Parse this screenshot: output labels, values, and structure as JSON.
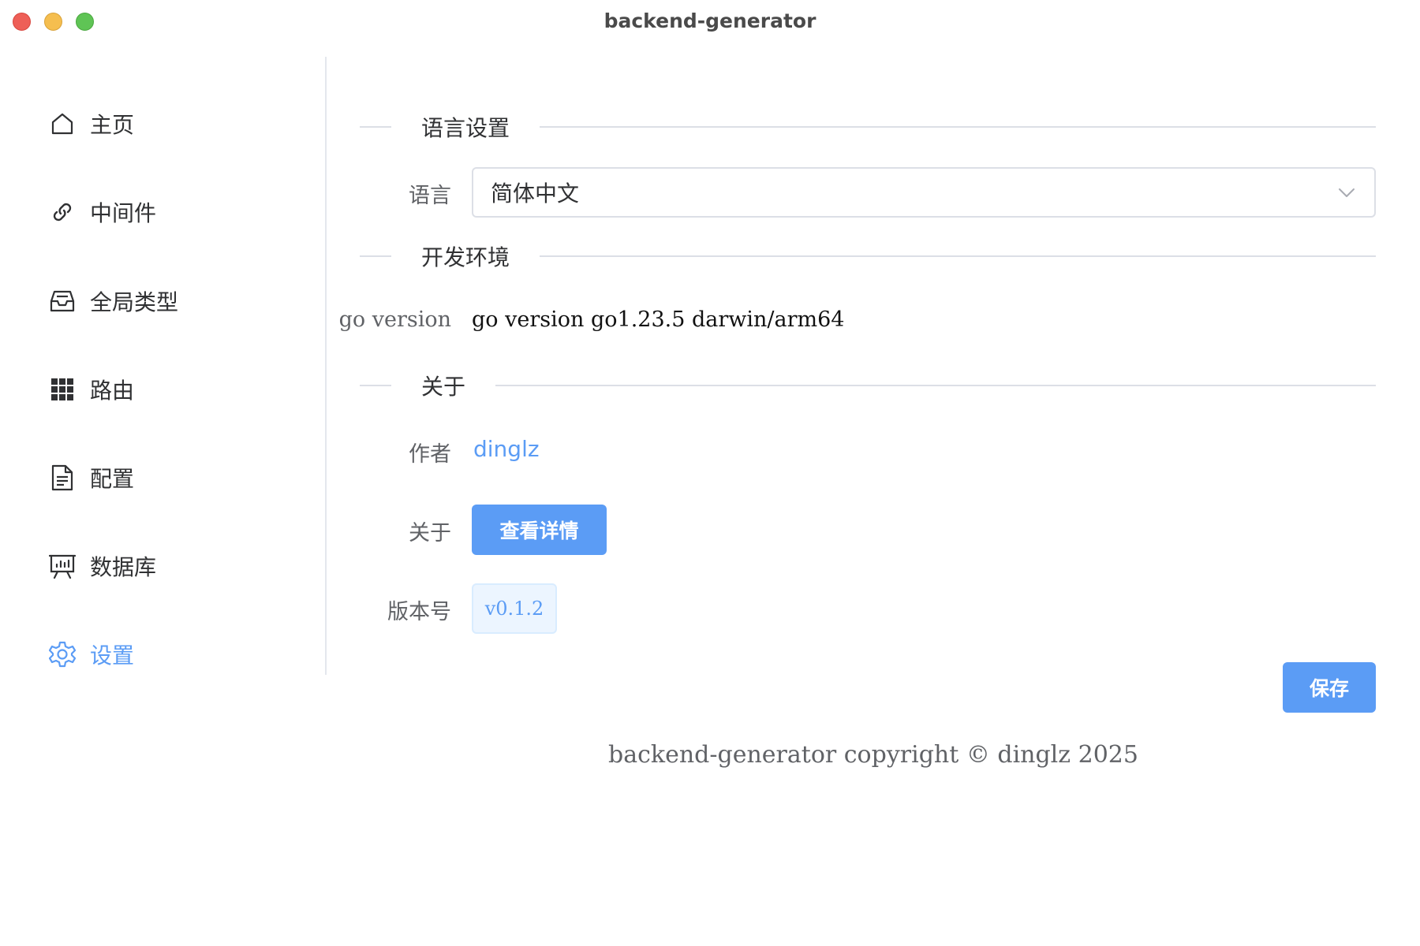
{
  "window": {
    "title": "backend-generator"
  },
  "sidebar": {
    "items": [
      {
        "label": "主页",
        "icon": "home-icon",
        "active": false
      },
      {
        "label": "中间件",
        "icon": "link-icon",
        "active": false
      },
      {
        "label": "全局类型",
        "icon": "inbox-icon",
        "active": false
      },
      {
        "label": "路由",
        "icon": "grid-icon",
        "active": false
      },
      {
        "label": "配置",
        "icon": "document-icon",
        "active": false
      },
      {
        "label": "数据库",
        "icon": "presentation-icon",
        "active": false
      },
      {
        "label": "设置",
        "icon": "gear-icon",
        "active": true
      }
    ]
  },
  "settings": {
    "language_section": {
      "title": "语言设置",
      "language_label": "语言",
      "language_value": "简体中文"
    },
    "dev_env_section": {
      "title": "开发环境",
      "go_version_label": "go version",
      "go_version_value": "go version go1.23.5 darwin/arm64"
    },
    "about_section": {
      "title": "关于",
      "author_label": "作者",
      "author_value": "dinglz",
      "about_label": "关于",
      "details_button": "查看详情",
      "version_label": "版本号",
      "version_value": "v0.1.2"
    },
    "save_button": "保存"
  },
  "footer": {
    "text": "backend-generator copyright © dinglz 2025"
  },
  "colors": {
    "accent": "#5b9cf5",
    "divider": "#dcdfe6",
    "tag_bg": "#ecf5ff"
  }
}
